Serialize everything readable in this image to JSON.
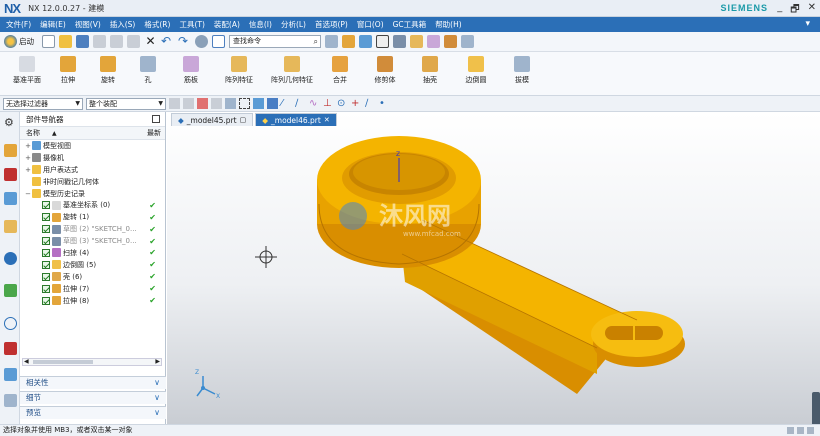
{
  "app": {
    "logo": "NX",
    "title": "NX 12.0.0.27 - 建模",
    "vendor": "SIEMENS"
  },
  "menu": [
    "文件(F)",
    "编辑(E)",
    "视图(V)",
    "插入(S)",
    "格式(R)",
    "工具(T)",
    "装配(A)",
    "信息(I)",
    "分析(L)",
    "首选项(P)",
    "窗口(O)",
    "GC工具箱",
    "帮助(H)"
  ],
  "toolbar": {
    "start_label": "启动",
    "command_search_placeholder": "查找命令"
  },
  "ribbon": [
    {
      "label": "基准平面",
      "color": "#d7dbe2"
    },
    {
      "label": "拉伸",
      "color": "#e3a53a"
    },
    {
      "label": "旋转",
      "color": "#e3a53a"
    },
    {
      "label": "孔",
      "color": "#9fb4cc"
    },
    {
      "label": "筋板",
      "color": "#c9a7d8"
    },
    {
      "label": "阵列特征",
      "color": "#e6b85a"
    },
    {
      "label": "阵列几何特征",
      "color": "#e6b85a"
    },
    {
      "label": "合并",
      "color": "#e6a23f"
    },
    {
      "label": "修剪体",
      "color": "#d18c3a"
    },
    {
      "label": "抽壳",
      "color": "#e0a84a"
    },
    {
      "label": "边倒圆",
      "color": "#f0c04a"
    },
    {
      "label": "拔模",
      "color": "#9fb4cc"
    }
  ],
  "selection": {
    "filter_value": "无选择过滤器",
    "scope_value": "整个装配"
  },
  "navigator": {
    "title": "部件导航器",
    "col_name": "名称",
    "col_latest": "最新",
    "rows": [
      {
        "label": "模型视图",
        "toggle": "+",
        "icon": "#5a9bd5",
        "checkbox": false,
        "latest": "",
        "dim": false,
        "indent": 0
      },
      {
        "label": "摄像机",
        "toggle": "+",
        "icon": "#8a8a8a",
        "checkbox": false,
        "latest": "",
        "dim": false,
        "indent": 0
      },
      {
        "label": "用户表达式",
        "toggle": "+",
        "icon": "#f0c040",
        "checkbox": false,
        "latest": "",
        "dim": false,
        "indent": 0
      },
      {
        "label": "非时间戳记几何体",
        "toggle": "",
        "icon": "#f0c040",
        "checkbox": false,
        "latest": "",
        "dim": false,
        "indent": 0
      },
      {
        "label": "模型历史记录",
        "toggle": "−",
        "icon": "#f0c040",
        "checkbox": false,
        "latest": "",
        "dim": false,
        "indent": 0
      },
      {
        "label": "基准坐标系 (0)",
        "toggle": "",
        "icon": "#d9d9d9",
        "checkbox": true,
        "latest": "✔",
        "dim": false,
        "indent": 1
      },
      {
        "label": "旋转 (1)",
        "toggle": "",
        "icon": "#e3a53a",
        "checkbox": true,
        "latest": "✔",
        "dim": false,
        "indent": 1
      },
      {
        "label": "草图 (2) \"SKETCH_0...",
        "toggle": "",
        "icon": "#7a8ea8",
        "checkbox": true,
        "latest": "✔",
        "dim": true,
        "indent": 1
      },
      {
        "label": "草图 (3) \"SKETCH_0...",
        "toggle": "",
        "icon": "#7a8ea8",
        "checkbox": true,
        "latest": "✔",
        "dim": true,
        "indent": 1
      },
      {
        "label": "扫掠 (4)",
        "toggle": "",
        "icon": "#b56fc4",
        "checkbox": true,
        "latest": "✔",
        "dim": false,
        "indent": 1
      },
      {
        "label": "边倒圆 (5)",
        "toggle": "",
        "icon": "#f0c04a",
        "checkbox": true,
        "latest": "✔",
        "dim": false,
        "indent": 1
      },
      {
        "label": "壳 (6)",
        "toggle": "",
        "icon": "#e0a84a",
        "checkbox": true,
        "latest": "✔",
        "dim": false,
        "indent": 1
      },
      {
        "label": "拉伸 (7)",
        "toggle": "",
        "icon": "#e3a53a",
        "checkbox": true,
        "latest": "✔",
        "dim": false,
        "indent": 1
      },
      {
        "label": "拉伸 (8)",
        "toggle": "",
        "icon": "#e3a53a",
        "checkbox": true,
        "latest": "✔",
        "dim": false,
        "indent": 1
      }
    ],
    "sections": [
      "相关性",
      "细节",
      "预览"
    ]
  },
  "tabs": [
    {
      "label": "_model45.prt",
      "active": false
    },
    {
      "label": "_model46.prt",
      "active": true
    }
  ],
  "viewport": {
    "watermark": "沐风网",
    "watermark_url": "www.mfcad.com",
    "part_color": "#f4b400"
  },
  "status": {
    "message": "选择对象并使用 MB3，或者双击某一对象"
  }
}
